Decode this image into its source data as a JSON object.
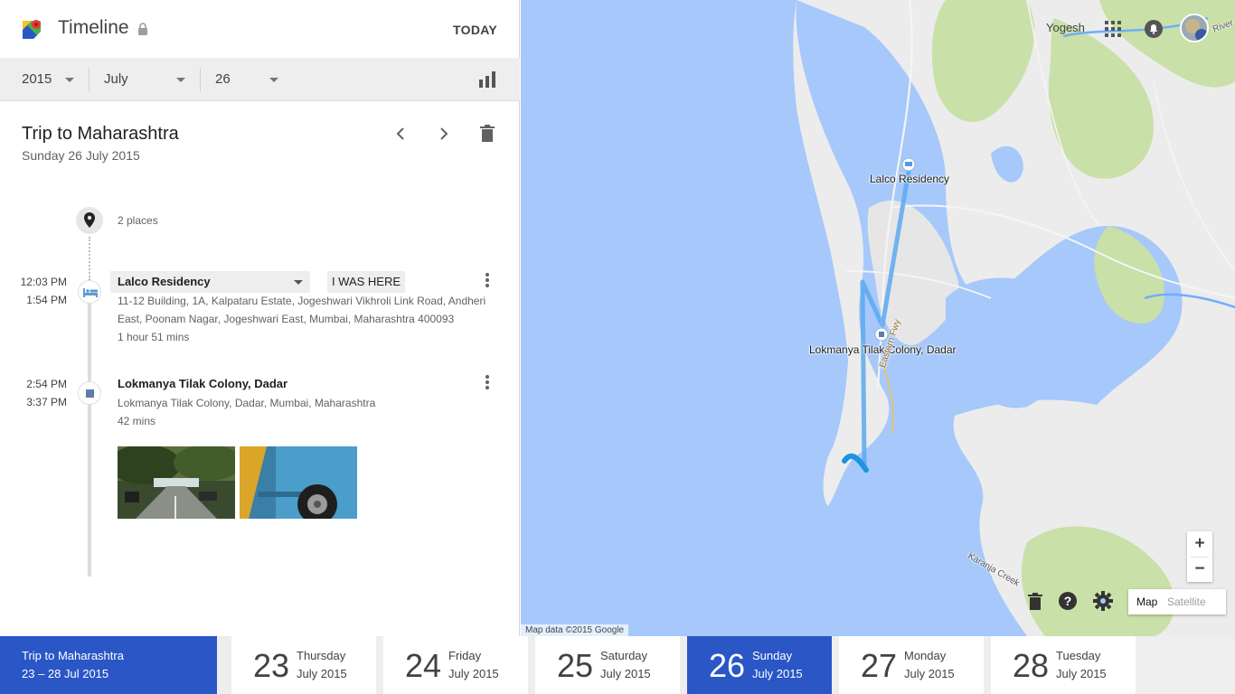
{
  "app": {
    "title": "Timeline",
    "today_label": "TODAY"
  },
  "date_selectors": {
    "year": "2015",
    "month": "July",
    "day": "26"
  },
  "trip": {
    "title": "Trip to Maharashtra",
    "date": "Sunday 26 July 2015",
    "places_count": "2 places"
  },
  "places": [
    {
      "start": "12:03 PM",
      "end": "1:54 PM",
      "name": "Lalco Residency",
      "action": "I WAS HERE",
      "address_line1": "11-12 Building, 1A, Kalpataru Estate, Jogeshwari Vikhroli Link Road, Andheri",
      "address_line2": "East, Poonam Nagar, Jogeshwari East, Mumbai, Maharashtra 400093",
      "duration": "1 hour 51 mins",
      "icon": "hotel-icon"
    },
    {
      "start": "2:54 PM",
      "end": "3:37 PM",
      "name": "Lokmanya Tilak Colony, Dadar",
      "address_line1": "Lokmanya Tilak Colony, Dadar, Mumbai, Maharashtra",
      "duration": "42 mins",
      "icon": "square-place-icon"
    }
  ],
  "map": {
    "user_name": "Yogesh",
    "labels": {
      "place1": "Lalco Residency",
      "place2": "Lokmanya Tilak Colony, Dadar",
      "road": "Eastern Fwy",
      "creek": "Karanja Creek",
      "river": "River"
    },
    "attribution": "Map data ©2015 Google",
    "zoom_in": "+",
    "zoom_out": "−",
    "map_type": {
      "map": "Map",
      "satellite": "Satellite"
    },
    "colors": {
      "water": "#a6c8fb",
      "land": "#ececec",
      "park": "#c9e0a8",
      "route": "#5aa9ef",
      "route_dark": "#1a95e0"
    }
  },
  "strip": {
    "trip_card": {
      "title": "Trip to Maharashtra",
      "range": "23 – 28 Jul 2015"
    },
    "days": [
      {
        "num": "23",
        "name": "Thursday",
        "month": "July 2015"
      },
      {
        "num": "24",
        "name": "Friday",
        "month": "July 2015"
      },
      {
        "num": "25",
        "name": "Saturday",
        "month": "July 2015"
      },
      {
        "num": "26",
        "name": "Sunday",
        "month": "July 2015",
        "active": true
      },
      {
        "num": "27",
        "name": "Monday",
        "month": "July 2015"
      },
      {
        "num": "28",
        "name": "Tuesday",
        "month": "July 2015"
      }
    ]
  },
  "colors": {
    "accent": "#2a56c6"
  }
}
